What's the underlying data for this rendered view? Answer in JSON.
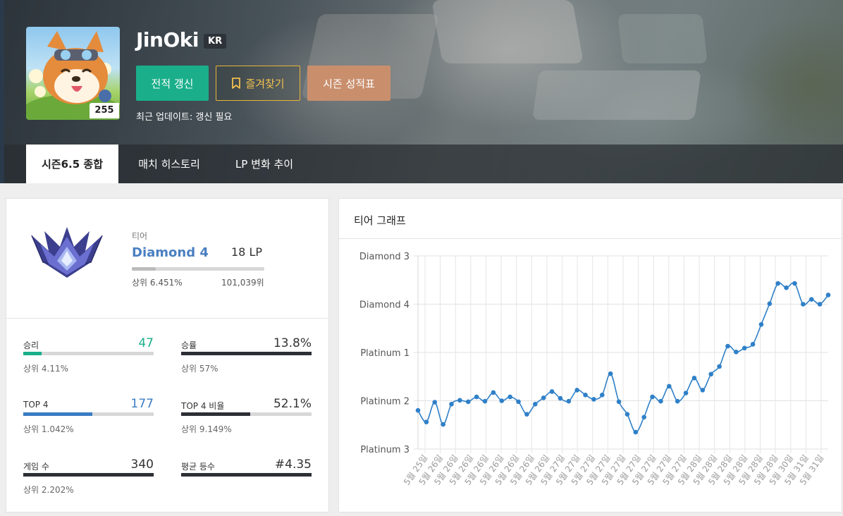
{
  "profile": {
    "name": "JinOki",
    "region": "KR",
    "level": "255",
    "refresh_label": "전적 갱신",
    "favorite_label": "즐겨찾기",
    "season_label": "시즌 성적표",
    "update_text": "최근 업데이트: 갱신 필요"
  },
  "tabs": [
    {
      "label": "시즌6.5 종합"
    },
    {
      "label": "매치 히스토리"
    },
    {
      "label": "LP 변화 추이"
    }
  ],
  "tier": {
    "label": "티어",
    "name": "Diamond 4",
    "lp": "18 LP",
    "rank": "상위 6.451%",
    "count": "101,039위",
    "lp_progress": 0.18
  },
  "stats": [
    {
      "label": "승리",
      "value": "47",
      "sub": "상위 4.11%",
      "fill": 0.14,
      "color": "#1aaf8a",
      "value_style": "green"
    },
    {
      "label": "승률",
      "value": "13.8%",
      "sub": "상위 57%",
      "fill": 1.0,
      "color": "#2d2f36",
      "value_style": ""
    },
    {
      "label": "TOP 4",
      "value": "177",
      "sub": "상위 1.042%",
      "fill": 0.53,
      "color": "#3a7cc4",
      "value_style": "blue"
    },
    {
      "label": "TOP 4 비율",
      "value": "52.1%",
      "sub": "상위 9.149%",
      "fill": 0.53,
      "color": "#2d2f36",
      "value_style": ""
    },
    {
      "label": "게임 수",
      "value": "340",
      "sub": "상위 2.202%",
      "fill": 1.0,
      "color": "#2d2f36",
      "value_style": ""
    },
    {
      "label": "평균 등수",
      "value": "#4.35",
      "sub": "",
      "fill": 1.0,
      "color": "#2d2f36",
      "value_style": ""
    }
  ],
  "graph": {
    "title": "티어 그래프"
  },
  "chart_data": {
    "type": "line",
    "title": "티어 그래프",
    "y_categories": [
      "Platinum 3",
      "Platinum 2",
      "Platinum 1",
      "Diamond 4",
      "Diamond 3"
    ],
    "ylim": [
      0,
      4
    ],
    "x_labels": [
      "5월 25일",
      "5월 26일",
      "5월 26일",
      "5월 26일",
      "5월 26일",
      "5월 26일",
      "5월 26일",
      "5월 26일",
      "5월 26일",
      "5월 27일",
      "5월 27일",
      "5월 27일",
      "5월 27일",
      "5월 27일",
      "5월 27일",
      "5월 27일",
      "5월 27일",
      "5월 27일",
      "5월 28일",
      "5월 28일",
      "5월 28일",
      "5월 28일",
      "5월 28일",
      "5월 28일",
      "5월 30일",
      "5월 31일",
      "5월 31일"
    ],
    "values": [
      0.8,
      0.56,
      0.97,
      0.51,
      0.93,
      1.01,
      0.98,
      1.08,
      0.99,
      1.17,
      1.0,
      1.08,
      0.98,
      0.72,
      0.93,
      1.06,
      1.19,
      1.05,
      0.99,
      1.22,
      1.12,
      1.03,
      1.12,
      1.56,
      0.98,
      0.72,
      0.35,
      0.66,
      1.08,
      0.99,
      1.3,
      0.99,
      1.16,
      1.47,
      1.22,
      1.55,
      1.71,
      2.13,
      2.01,
      2.09,
      2.17,
      2.58,
      3.01,
      3.43,
      3.34,
      3.43,
      3.0,
      3.1,
      3.0,
      3.19
    ],
    "series_color": "#2f80c8",
    "grid": true
  }
}
